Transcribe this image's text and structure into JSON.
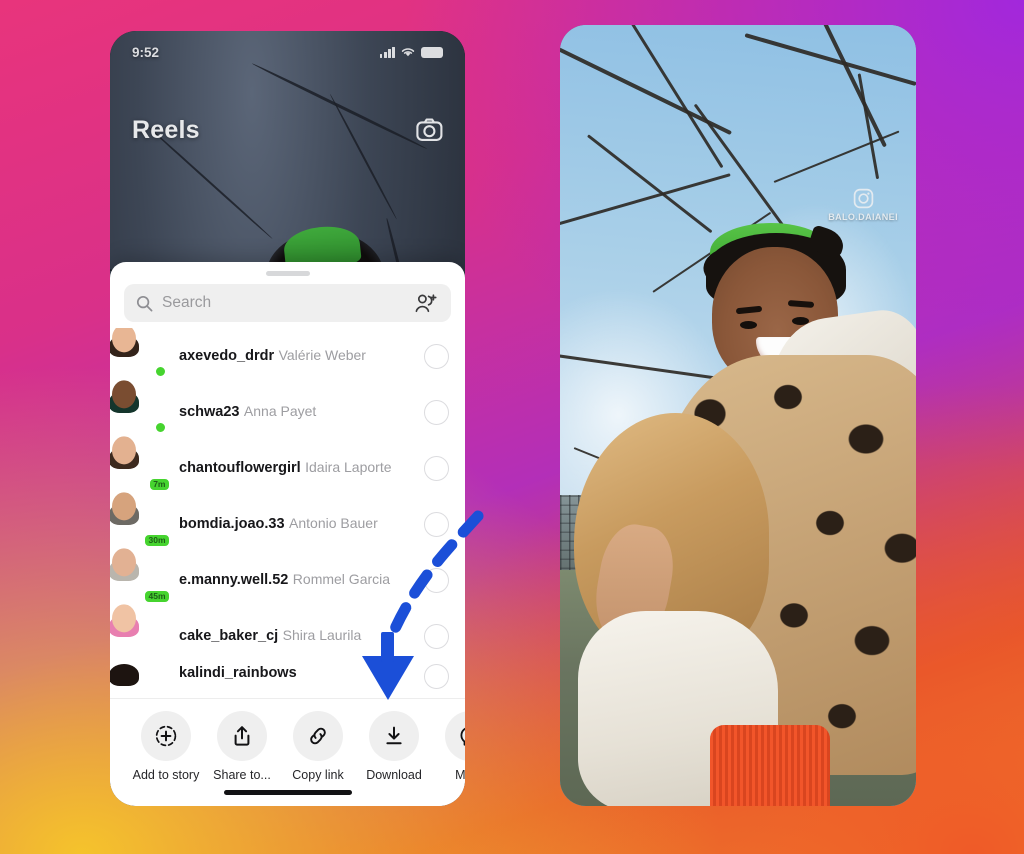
{
  "background": {
    "gradient_colors": [
      "#E8347C",
      "#A228DC",
      "#EF5A28",
      "#F5C32C"
    ]
  },
  "left_phone": {
    "status_bar": {
      "time": "9:52",
      "signal_icon": "cellular-bars-icon",
      "wifi_icon": "wifi-icon",
      "battery_icon": "battery-icon"
    },
    "header": {
      "title": "Reels",
      "camera_icon": "camera-icon"
    },
    "share_sheet": {
      "grabber": "drag-handle",
      "search": {
        "placeholder": "Search",
        "value": "",
        "icon": "search-icon",
        "add_people_icon": "add-people-icon"
      },
      "recipients": [
        {
          "username": "axevedo_drdr",
          "full_name": "Valérie Weber",
          "status": "online",
          "badge": ""
        },
        {
          "username": "schwa23",
          "full_name": "Anna Payet",
          "status": "online",
          "badge": ""
        },
        {
          "username": "chantouflowergirl",
          "full_name": "Idaira Laporte",
          "status": "recent",
          "badge": "7m"
        },
        {
          "username": "bomdia.joao.33",
          "full_name": "Antonio Bauer",
          "status": "recent",
          "badge": "30m"
        },
        {
          "username": "e.manny.well.52",
          "full_name": "Rommel Garcia",
          "status": "recent",
          "badge": "45m"
        },
        {
          "username": "cake_baker_cj",
          "full_name": "Shira Laurila",
          "status": "recent",
          "badge": ""
        },
        {
          "username": "kalindi_rainbows",
          "full_name": "",
          "status": "none",
          "badge": ""
        }
      ],
      "actions": [
        {
          "label": "Add to story",
          "icon": "add-to-story-icon"
        },
        {
          "label": "Share to...",
          "icon": "share-upload-icon"
        },
        {
          "label": "Copy link",
          "icon": "link-icon"
        },
        {
          "label": "Download",
          "icon": "download-icon"
        },
        {
          "label": "Mess",
          "icon": "messenger-icon"
        }
      ]
    }
  },
  "right_phone": {
    "watermark": {
      "platform_icon": "instagram-icon",
      "username": "BALO.DAIANEI"
    }
  },
  "annotation": {
    "type": "dashed-curved-arrow",
    "color": "#1B4FD8",
    "points_to": "Download"
  }
}
